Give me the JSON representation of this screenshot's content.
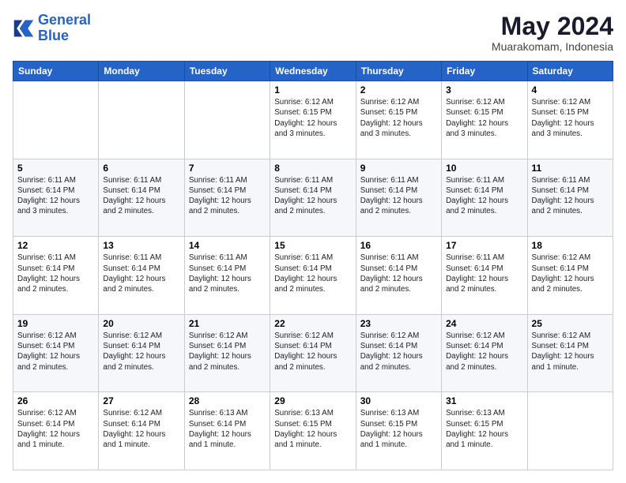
{
  "logo": {
    "line1": "General",
    "line2": "Blue"
  },
  "title": "May 2024",
  "location": "Muarakomam, Indonesia",
  "weekdays": [
    "Sunday",
    "Monday",
    "Tuesday",
    "Wednesday",
    "Thursday",
    "Friday",
    "Saturday"
  ],
  "weeks": [
    [
      {
        "day": "",
        "info": ""
      },
      {
        "day": "",
        "info": ""
      },
      {
        "day": "",
        "info": ""
      },
      {
        "day": "1",
        "info": "Sunrise: 6:12 AM\nSunset: 6:15 PM\nDaylight: 12 hours\nand 3 minutes."
      },
      {
        "day": "2",
        "info": "Sunrise: 6:12 AM\nSunset: 6:15 PM\nDaylight: 12 hours\nand 3 minutes."
      },
      {
        "day": "3",
        "info": "Sunrise: 6:12 AM\nSunset: 6:15 PM\nDaylight: 12 hours\nand 3 minutes."
      },
      {
        "day": "4",
        "info": "Sunrise: 6:12 AM\nSunset: 6:15 PM\nDaylight: 12 hours\nand 3 minutes."
      }
    ],
    [
      {
        "day": "5",
        "info": "Sunrise: 6:11 AM\nSunset: 6:14 PM\nDaylight: 12 hours\nand 3 minutes."
      },
      {
        "day": "6",
        "info": "Sunrise: 6:11 AM\nSunset: 6:14 PM\nDaylight: 12 hours\nand 2 minutes."
      },
      {
        "day": "7",
        "info": "Sunrise: 6:11 AM\nSunset: 6:14 PM\nDaylight: 12 hours\nand 2 minutes."
      },
      {
        "day": "8",
        "info": "Sunrise: 6:11 AM\nSunset: 6:14 PM\nDaylight: 12 hours\nand 2 minutes."
      },
      {
        "day": "9",
        "info": "Sunrise: 6:11 AM\nSunset: 6:14 PM\nDaylight: 12 hours\nand 2 minutes."
      },
      {
        "day": "10",
        "info": "Sunrise: 6:11 AM\nSunset: 6:14 PM\nDaylight: 12 hours\nand 2 minutes."
      },
      {
        "day": "11",
        "info": "Sunrise: 6:11 AM\nSunset: 6:14 PM\nDaylight: 12 hours\nand 2 minutes."
      }
    ],
    [
      {
        "day": "12",
        "info": "Sunrise: 6:11 AM\nSunset: 6:14 PM\nDaylight: 12 hours\nand 2 minutes."
      },
      {
        "day": "13",
        "info": "Sunrise: 6:11 AM\nSunset: 6:14 PM\nDaylight: 12 hours\nand 2 minutes."
      },
      {
        "day": "14",
        "info": "Sunrise: 6:11 AM\nSunset: 6:14 PM\nDaylight: 12 hours\nand 2 minutes."
      },
      {
        "day": "15",
        "info": "Sunrise: 6:11 AM\nSunset: 6:14 PM\nDaylight: 12 hours\nand 2 minutes."
      },
      {
        "day": "16",
        "info": "Sunrise: 6:11 AM\nSunset: 6:14 PM\nDaylight: 12 hours\nand 2 minutes."
      },
      {
        "day": "17",
        "info": "Sunrise: 6:11 AM\nSunset: 6:14 PM\nDaylight: 12 hours\nand 2 minutes."
      },
      {
        "day": "18",
        "info": "Sunrise: 6:12 AM\nSunset: 6:14 PM\nDaylight: 12 hours\nand 2 minutes."
      }
    ],
    [
      {
        "day": "19",
        "info": "Sunrise: 6:12 AM\nSunset: 6:14 PM\nDaylight: 12 hours\nand 2 minutes."
      },
      {
        "day": "20",
        "info": "Sunrise: 6:12 AM\nSunset: 6:14 PM\nDaylight: 12 hours\nand 2 minutes."
      },
      {
        "day": "21",
        "info": "Sunrise: 6:12 AM\nSunset: 6:14 PM\nDaylight: 12 hours\nand 2 minutes."
      },
      {
        "day": "22",
        "info": "Sunrise: 6:12 AM\nSunset: 6:14 PM\nDaylight: 12 hours\nand 2 minutes."
      },
      {
        "day": "23",
        "info": "Sunrise: 6:12 AM\nSunset: 6:14 PM\nDaylight: 12 hours\nand 2 minutes."
      },
      {
        "day": "24",
        "info": "Sunrise: 6:12 AM\nSunset: 6:14 PM\nDaylight: 12 hours\nand 2 minutes."
      },
      {
        "day": "25",
        "info": "Sunrise: 6:12 AM\nSunset: 6:14 PM\nDaylight: 12 hours\nand 1 minute."
      }
    ],
    [
      {
        "day": "26",
        "info": "Sunrise: 6:12 AM\nSunset: 6:14 PM\nDaylight: 12 hours\nand 1 minute."
      },
      {
        "day": "27",
        "info": "Sunrise: 6:12 AM\nSunset: 6:14 PM\nDaylight: 12 hours\nand 1 minute."
      },
      {
        "day": "28",
        "info": "Sunrise: 6:13 AM\nSunset: 6:14 PM\nDaylight: 12 hours\nand 1 minute."
      },
      {
        "day": "29",
        "info": "Sunrise: 6:13 AM\nSunset: 6:15 PM\nDaylight: 12 hours\nand 1 minute."
      },
      {
        "day": "30",
        "info": "Sunrise: 6:13 AM\nSunset: 6:15 PM\nDaylight: 12 hours\nand 1 minute."
      },
      {
        "day": "31",
        "info": "Sunrise: 6:13 AM\nSunset: 6:15 PM\nDaylight: 12 hours\nand 1 minute."
      },
      {
        "day": "",
        "info": ""
      }
    ]
  ]
}
